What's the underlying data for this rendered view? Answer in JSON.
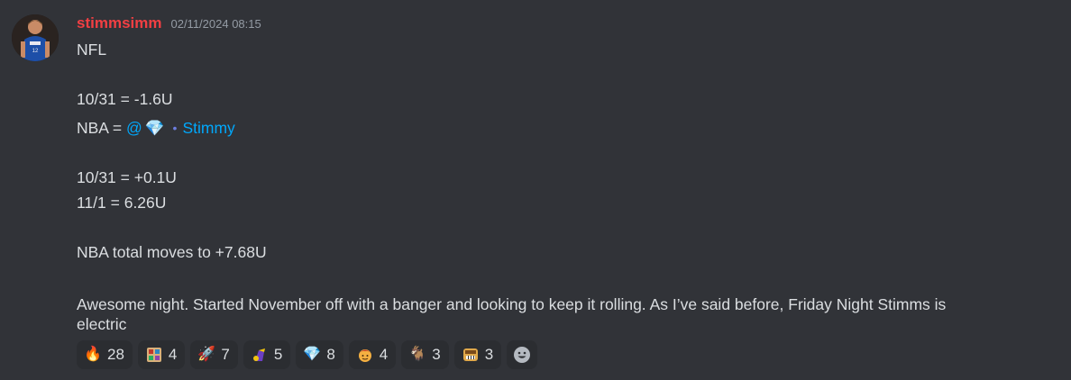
{
  "message": {
    "username": "stimmsimm",
    "timestamp": "02/11/2024 08:15",
    "lines": {
      "l1": "NFL",
      "l2": "10/31 = -1.6U",
      "l3_prefix": "NBA = ",
      "l3_mention_at": "@",
      "l3_mention_name": "Stimmy",
      "l4": "10/31 = +0.1U",
      "l5": "11/1 = 6.26U",
      "l6": "NBA total moves to +7.68U",
      "l7": "Awesome night. Started November off with a banger and looking to keep it rolling. As I’ve said before, Friday Night Stimms is",
      "l8": "electric"
    }
  },
  "reactions": [
    {
      "icon": "fire-icon",
      "count": "28"
    },
    {
      "icon": "custom-sticker-icon",
      "count": "4"
    },
    {
      "icon": "rocket-icon",
      "count": "7"
    },
    {
      "icon": "money-bag-icon",
      "count": "5"
    },
    {
      "icon": "gem-icon",
      "count": "8"
    },
    {
      "icon": "face-icon",
      "count": "4"
    },
    {
      "icon": "goat-icon",
      "count": "3"
    },
    {
      "icon": "custom-face-icon",
      "count": "3"
    }
  ],
  "colors": {
    "background": "#313338",
    "username": "#f23f43",
    "mention": "#00a8fc",
    "reaction_bg": "#2b2d31"
  }
}
